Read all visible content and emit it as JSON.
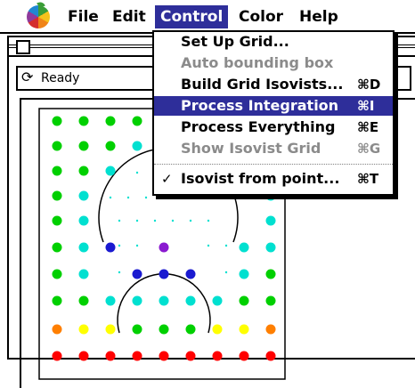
{
  "menubar": {
    "items": [
      "File",
      "Edit",
      "Control",
      "Color",
      "Help"
    ],
    "active": "Control"
  },
  "window": {
    "status": "Ready"
  },
  "control_menu": {
    "items": [
      {
        "label": "Set Up Grid...",
        "shortcut": "",
        "enabled": true,
        "checked": false,
        "highlighted": false
      },
      {
        "label": "Auto bounding box",
        "shortcut": "",
        "enabled": false,
        "checked": false,
        "highlighted": false
      },
      {
        "label": "Build Grid Isovists...",
        "shortcut": "⌘D",
        "enabled": true,
        "checked": false,
        "highlighted": false
      },
      {
        "label": "Process Integration",
        "shortcut": "⌘I",
        "enabled": true,
        "checked": false,
        "highlighted": true
      },
      {
        "label": "Process Everything",
        "shortcut": "⌘E",
        "enabled": true,
        "checked": false,
        "highlighted": false
      },
      {
        "label": "Show Isovist Grid",
        "shortcut": "⌘G",
        "enabled": false,
        "checked": false,
        "highlighted": false
      },
      {
        "label": "Isovist from point...",
        "shortcut": "⌘T",
        "enabled": true,
        "checked": true,
        "highlighted": false
      }
    ]
  },
  "colors": {
    "highlight": "#2e2e9a",
    "disabled_text": "#8b8b8b",
    "dot_red": "#ff0000",
    "dot_orange": "#ff7f00",
    "dot_yellow": "#ffff00",
    "dot_green": "#00d000",
    "dot_cyan": "#00e0d0",
    "dot_blue": "#1a1ad0",
    "dot_purple": "#8a1ad0"
  }
}
